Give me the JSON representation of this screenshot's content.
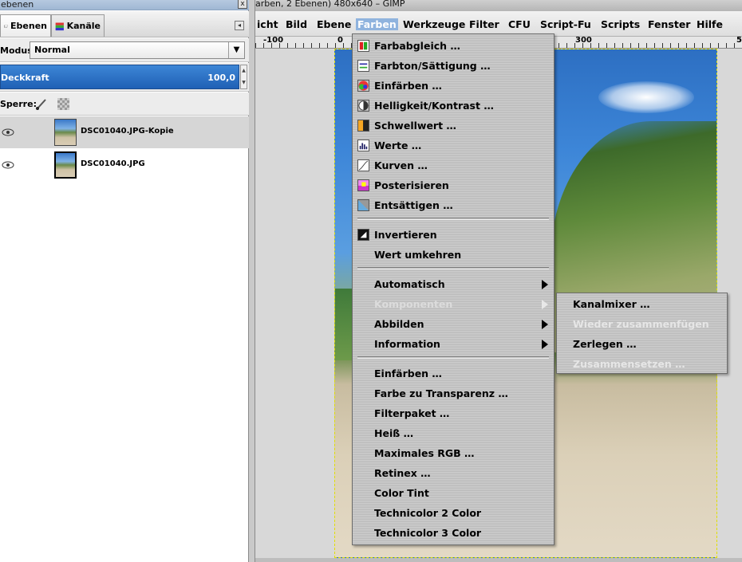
{
  "dock": {
    "title": "ebenen",
    "close_label": "x",
    "tabs": [
      {
        "label": "Ebenen"
      },
      {
        "label": "Kanäle"
      }
    ],
    "mode_label": "Modus:",
    "mode_value": "Normal",
    "opacity_label": "Deckkraft",
    "opacity_value": "100,0",
    "lock_label": "Sperre:",
    "layers": [
      {
        "name": "DSC01040.JPG-Kopie",
        "selected": true
      },
      {
        "name": "DSC01040.JPG",
        "selected": false
      }
    ]
  },
  "window": {
    "title": "arben, 2 Ebenen) 480x640 – GIMP",
    "menubar": [
      "icht",
      "Bild",
      "Ebene",
      "Farben",
      "Werkzeuge",
      "Filter",
      "CFU",
      "Script-Fu",
      "Scripts",
      "Fenster",
      "Hilfe"
    ],
    "active_menu": "Farben",
    "ruler_labels": [
      "-100",
      "0",
      "300",
      "5"
    ]
  },
  "farben_menu": {
    "group1": [
      {
        "label": "Farbabgleich …",
        "icon": "color-balance-icon"
      },
      {
        "label": "Farbton⁣/⁣Sättigung …",
        "icon": "hue-saturation-icon"
      },
      {
        "label": "Einfärben …",
        "icon": "colorize-icon"
      },
      {
        "label": "Helligkeit⁣/⁣Kontrast …",
        "icon": "brightness-contrast-icon"
      },
      {
        "label": "Schwellwert …",
        "icon": "threshold-icon"
      },
      {
        "label": "Werte …",
        "icon": "levels-icon"
      },
      {
        "label": "Kurven …",
        "icon": "curves-icon"
      },
      {
        "label": "Posterisieren",
        "icon": "posterize-icon"
      },
      {
        "label": "Entsättigen …",
        "icon": "desaturate-icon"
      }
    ],
    "group2": [
      {
        "label": "Invertieren",
        "icon": "invert-icon"
      },
      {
        "label": "Wert umkehren",
        "icon": ""
      }
    ],
    "group3": [
      {
        "label": "Automatisch",
        "submenu": true,
        "disabled": false
      },
      {
        "label": "Komponenten",
        "submenu": true,
        "disabled": true
      },
      {
        "label": "Abbilden",
        "submenu": true,
        "disabled": false
      },
      {
        "label": "Information",
        "submenu": true,
        "disabled": false
      }
    ],
    "group4": [
      {
        "label": "Einfärben …"
      },
      {
        "label": "Farbe zu Transparenz …"
      },
      {
        "label": "Filterpaket …"
      },
      {
        "label": "Heiß …"
      },
      {
        "label": "Maximales RGB …"
      },
      {
        "label": "Retinex …"
      },
      {
        "label": "Color Tint"
      },
      {
        "label": "Technicolor 2 Color"
      },
      {
        "label": "Technicolor 3 Color"
      }
    ]
  },
  "komponenten_submenu": [
    {
      "label": "Kanalmixer …",
      "disabled": false
    },
    {
      "label": "Wieder zusammenfügen",
      "disabled": true
    },
    {
      "label": "Zerlegen …",
      "disabled": false
    },
    {
      "label": "Zusammensetzen …",
      "disabled": true
    }
  ]
}
